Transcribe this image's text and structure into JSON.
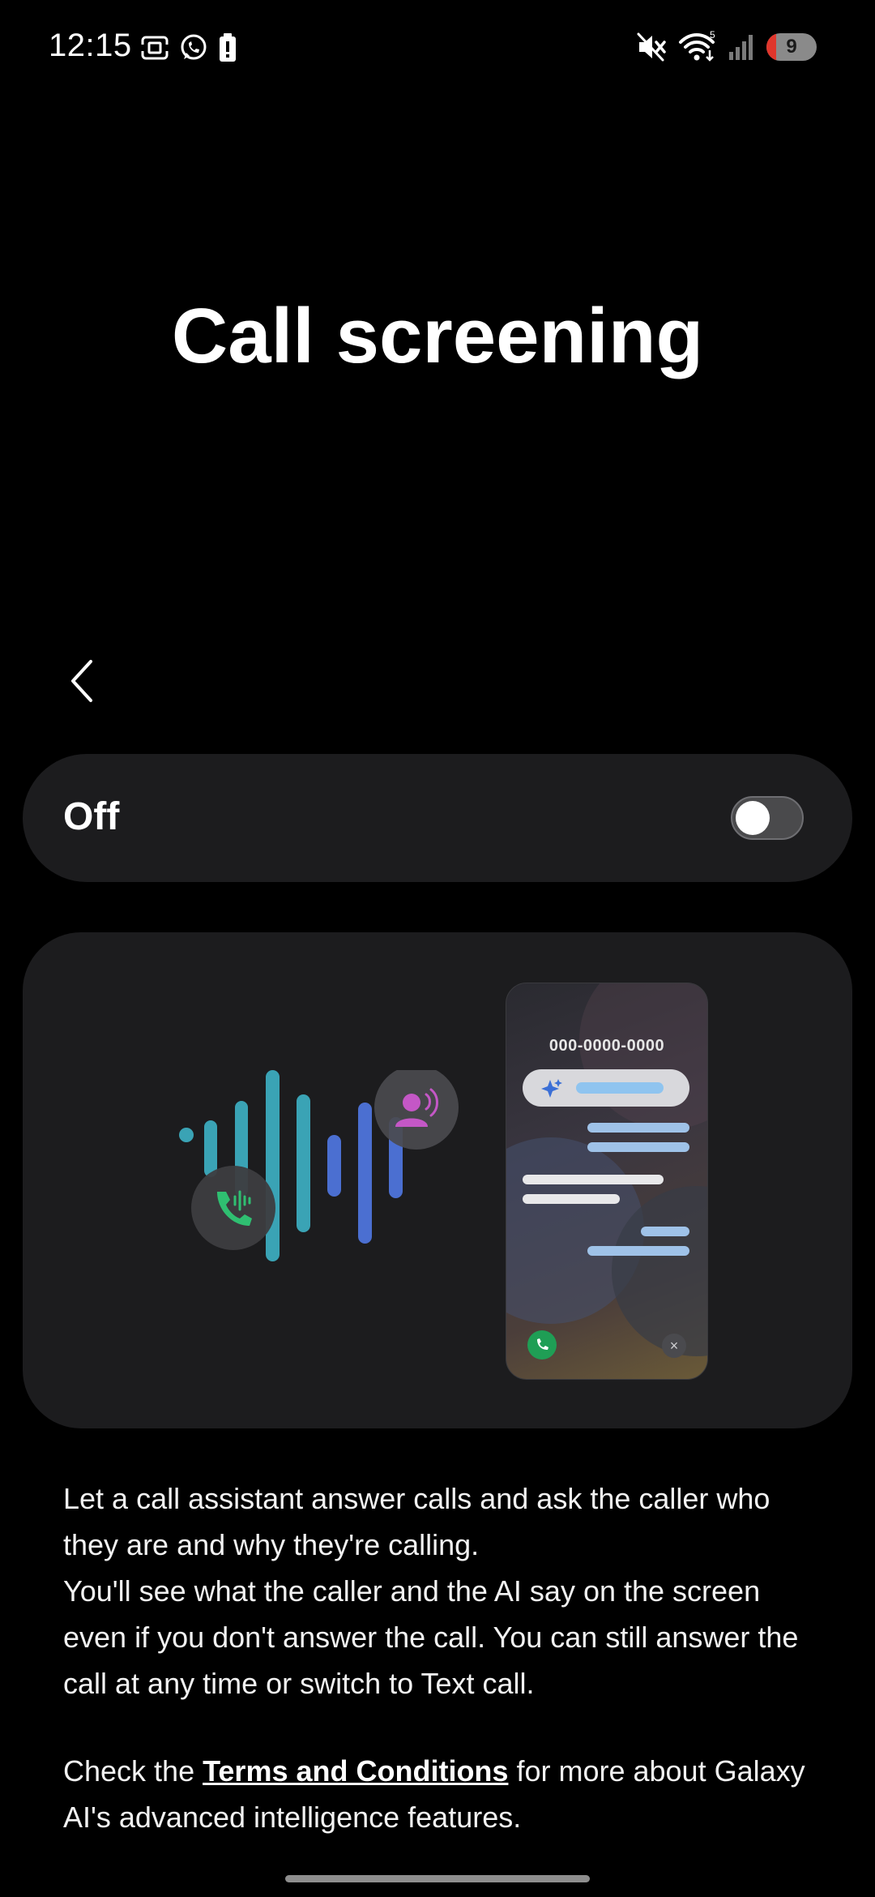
{
  "status_bar": {
    "time": "12:15",
    "left_icons": [
      "screenshot-icon",
      "whatsapp-icon",
      "battery-alert-icon"
    ],
    "right_icons": [
      "mute-icon",
      "wifi-icon",
      "signal-icon"
    ],
    "wifi_label": "5",
    "battery_level": "9",
    "battery_color": "#e0362c"
  },
  "header": {
    "title": "Call screening"
  },
  "navigation": {
    "back_icon": "chevron-left-icon"
  },
  "toggle": {
    "label": "Off",
    "state": false
  },
  "illustration": {
    "phone_number": "000-0000-0000",
    "icons": [
      "phone-wave-icon",
      "person-speaking-icon",
      "ai-sparkle-icon",
      "accept-call-icon",
      "decline-call-icon"
    ],
    "decline_glyph": "×",
    "accent_colors": {
      "teal": "#3aa3b5",
      "blue": "#4b6fd1",
      "green": "#2fbf71",
      "pink": "#c457c6"
    }
  },
  "description": {
    "paragraph_1": "Let a call assistant answer calls and ask the caller who they are and why they're calling.",
    "paragraph_2": "You'll see what the caller and the AI say on the screen even if you don't answer the call. You can still answer the call at any time or switch to Text call."
  },
  "terms": {
    "prefix": "Check the ",
    "link_label": "Terms and Conditions",
    "suffix": " for more about Galaxy AI's advanced intelligence features."
  }
}
